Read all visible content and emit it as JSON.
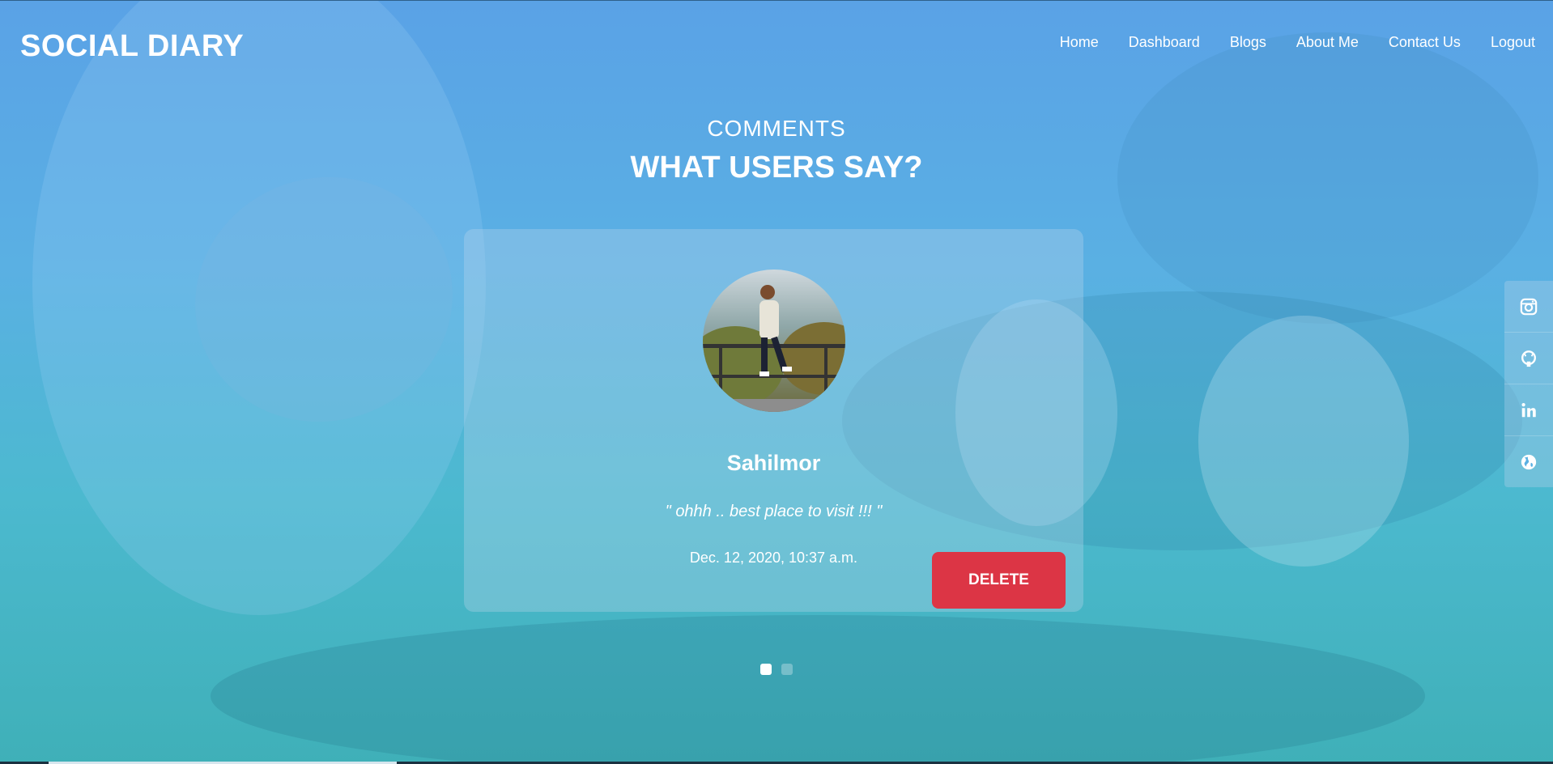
{
  "brand": "SOCIAL DIARY",
  "nav": {
    "items": [
      "Home",
      "Dashboard",
      "Blogs",
      "About Me",
      "Contact Us",
      "Logout"
    ]
  },
  "section": {
    "subtitle": "COMMENTS",
    "title": "WHAT USERS SAY?"
  },
  "comment_card": {
    "username": "Sahilmor",
    "comment": "\" ohhh .. best place to visit !!! \"",
    "date": "Dec. 12, 2020, 10:37 a.m.",
    "delete_label": "DELETE",
    "delete_color": "#dc3545"
  },
  "carousel": {
    "total": 2,
    "active_index": 0
  },
  "social_icons": [
    "instagram-icon",
    "github-icon",
    "linkedin-icon",
    "globe-icon"
  ],
  "colors": {
    "background_top": "#5aa2e6",
    "background_bottom": "#3fb0b8",
    "accent": "#dc3545"
  }
}
